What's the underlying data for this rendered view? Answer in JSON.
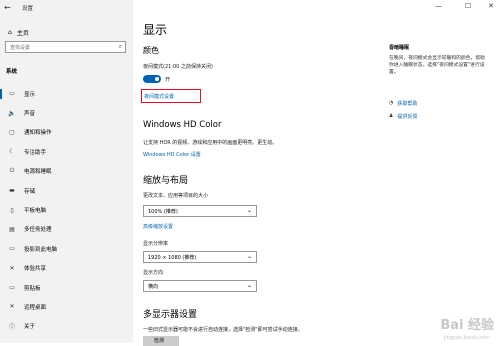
{
  "window": {
    "title": "设置",
    "minimize": "—",
    "maximize": "☐",
    "close": "✕"
  },
  "sidebar": {
    "home": "主页",
    "search_placeholder": "查找设置",
    "section": "系统",
    "items": [
      {
        "label": "显示",
        "icon": "monitor-icon",
        "glyph": "▭"
      },
      {
        "label": "声音",
        "icon": "speaker-icon",
        "glyph": "🔈"
      },
      {
        "label": "通知和操作",
        "icon": "notification-icon",
        "glyph": "▢"
      },
      {
        "label": "专注助手",
        "icon": "moon-icon",
        "glyph": "☾"
      },
      {
        "label": "电源和睡眠",
        "icon": "power-icon",
        "glyph": "⏻"
      },
      {
        "label": "存储",
        "icon": "storage-icon",
        "glyph": "▬"
      },
      {
        "label": "平板电脑",
        "icon": "tablet-icon",
        "glyph": "▯"
      },
      {
        "label": "多任务处理",
        "icon": "multitask-icon",
        "glyph": "▤"
      },
      {
        "label": "投影到此电脑",
        "icon": "project-icon",
        "glyph": "▭"
      },
      {
        "label": "体验共享",
        "icon": "share-icon",
        "glyph": "✕"
      },
      {
        "label": "剪贴板",
        "icon": "clipboard-icon",
        "glyph": "▭"
      },
      {
        "label": "远程桌面",
        "icon": "remote-icon",
        "glyph": "✕"
      },
      {
        "label": "关于",
        "icon": "info-icon",
        "glyph": "ⓘ"
      }
    ]
  },
  "main": {
    "title": "显示",
    "color_heading": "颜色",
    "night_light_label": "夜间模式(21:00 之前保持关闭)",
    "toggle_state": "开",
    "night_light_settings": "夜间模式设置",
    "hd_heading": "Windows HD Color",
    "hd_desc": "让支持 HDR 的视频、游戏和应用中的画面更明亮、更生动。",
    "hd_link": "Windows HD Color 设置",
    "scale_heading": "缩放与布局",
    "scale_label": "更改文本、应用等项目的大小",
    "scale_value": "100% (推荐)",
    "advanced_scale_link": "高级缩放设置",
    "resolution_label": "显示分辨率",
    "resolution_value": "1920 × 1080 (推荐)",
    "orientation_label": "显示方向",
    "orientation_value": "横向",
    "multi_heading": "多显示器设置",
    "multi_desc": "一些旧式显示器可能不会进行自动连接，选择\"检测\"即可尝试手动连接。",
    "detect_button": "检测"
  },
  "right": {
    "sleep_heading": "昏暗睡眠",
    "sleep_text": "在晚间，夜间模式会显示较暖和的颜色，帮助你进入睡眠状态。选择\"夜间模式设置\"进行设置。",
    "help": "获取帮助",
    "feedback": "提供反馈"
  },
  "watermark": {
    "brand": "Bai 经验",
    "url": "jingyan.baidu.com"
  }
}
